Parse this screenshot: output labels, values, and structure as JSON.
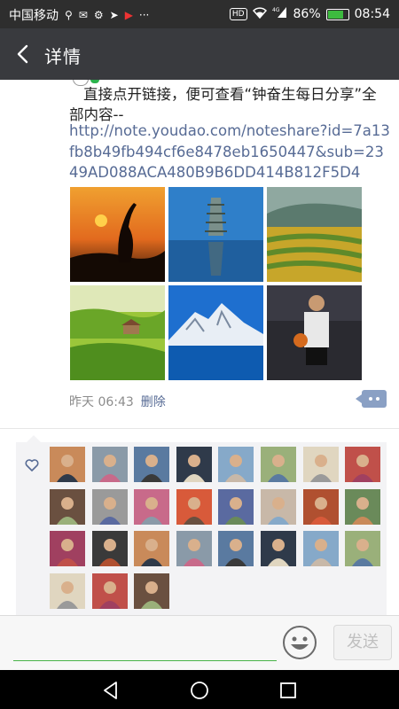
{
  "status_bar": {
    "carrier": "中国移动",
    "battery_text": "86%",
    "battery_level": 0.86,
    "time": "08:54",
    "hd_badge": "HD",
    "network": "4G",
    "icons": [
      "usb-icon",
      "signal-icon",
      "wifi-icon",
      "battery-icon"
    ]
  },
  "header": {
    "title": "详情",
    "back_icon": "back-arrow-icon"
  },
  "post": {
    "text": "直接点开链接，便可查看“钟奋生每日分享”全部内容--",
    "link": "http://note.youdao.com/noteshare?id=7a13fb8b49fb494cf6e8478eb1650447&sub=2349AD088ACA480B9B6DD414B812F5D4",
    "photos": [
      {
        "subject": "crane at sunset"
      },
      {
        "subject": "pagoda reflection"
      },
      {
        "subject": "terraced fields"
      },
      {
        "subject": "green hills farmhouse"
      },
      {
        "subject": "snow mountain lake"
      },
      {
        "subject": "basketball player"
      }
    ],
    "time": "昨天 06:43",
    "delete_label": "删除"
  },
  "likes": {
    "icon": "heart-outline-icon",
    "count": 27
  },
  "input_bar": {
    "placeholder": "",
    "send_label": "发送",
    "accent": "#47b347"
  },
  "colors": {
    "status_bg": "#2e2e2e",
    "title_bg": "#393a3e",
    "link": "#576b95",
    "likes_bg": "#f3f3f5"
  }
}
